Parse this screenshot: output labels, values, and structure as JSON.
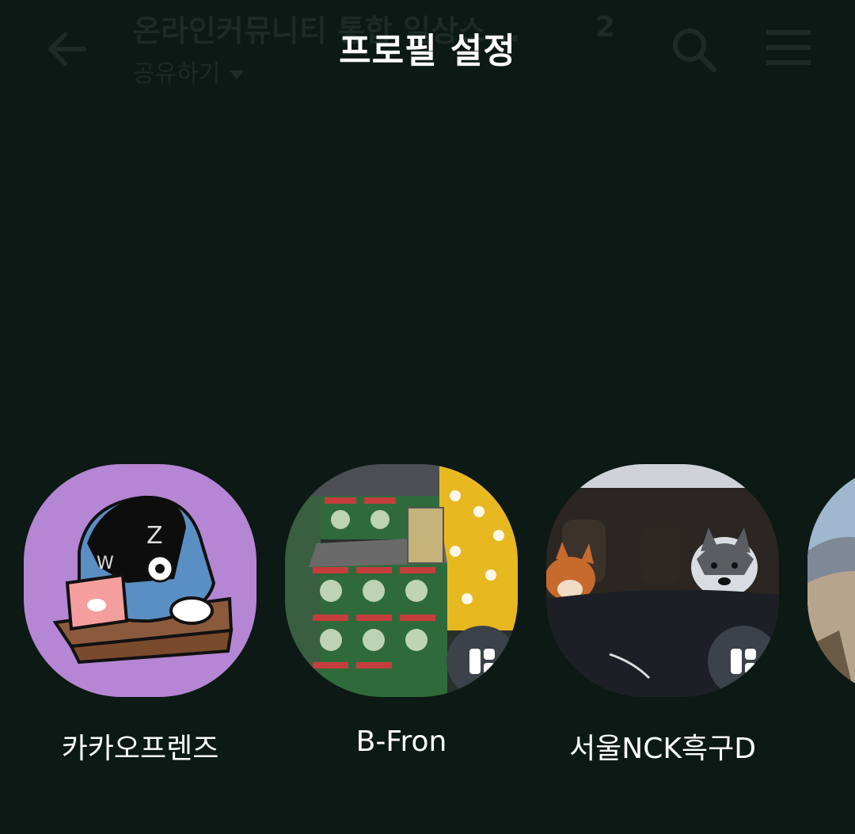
{
  "background_header": {
    "chat_title": "온라인커뮤니티 통합 일상스...",
    "member_count": "2",
    "share_label": "공유하기"
  },
  "page_title": "프로필 설정",
  "profiles": [
    {
      "name": "카카오프렌즈",
      "image": "kakao-ryan-sleeping-on-desk",
      "badge": false
    },
    {
      "name": "B-Fron",
      "image": "cereal-boxes-store-display",
      "badge": true
    },
    {
      "name": "서울NCK흑구D",
      "image": "dogs-in-car",
      "badge": true
    },
    {
      "name": "",
      "image": "mountain-landscape",
      "badge": false
    }
  ],
  "colors": {
    "background": "#0c1914",
    "kakao_avatar_bg": "#b586d3",
    "badge": "#3b4249",
    "text": "#ffffff"
  }
}
